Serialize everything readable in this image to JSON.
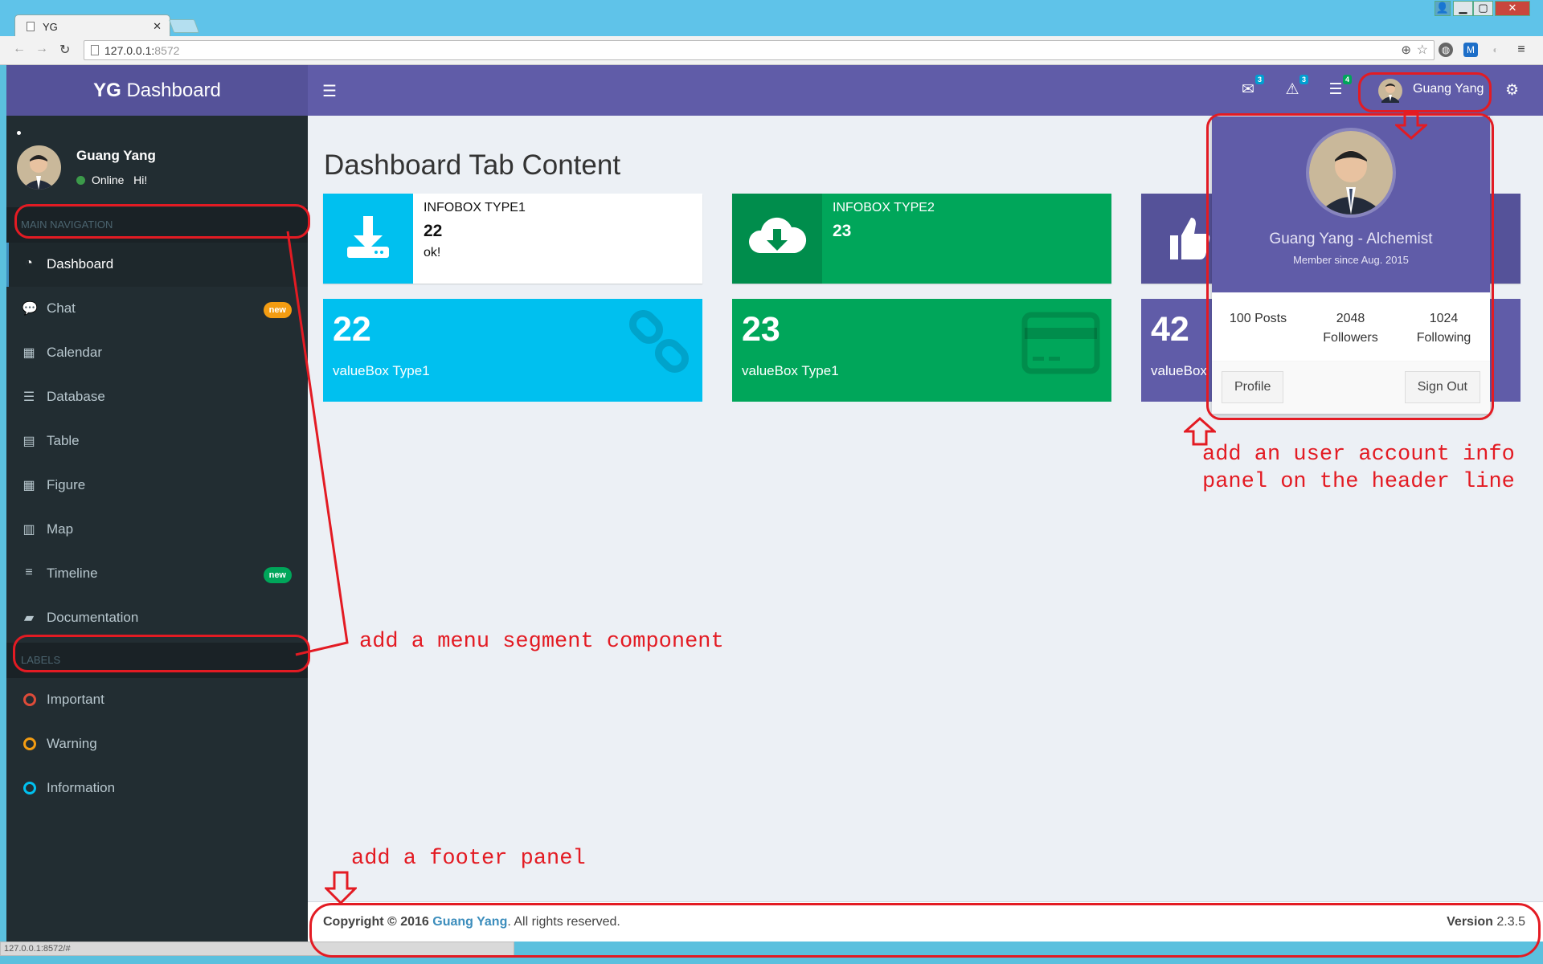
{
  "browser": {
    "tab_title": "YG",
    "url_host": "127.0.0.1:",
    "url_port": "8572",
    "status_url": "127.0.0.1:8572/#",
    "window_controls": [
      "user-icon",
      "minimize-icon",
      "maximize-icon",
      "close-icon"
    ]
  },
  "header": {
    "logo_bold": "YG",
    "logo_rest": " Dashboard",
    "messages_count": "3",
    "notifications_count": "3",
    "tasks_count": "4",
    "user_name": "Guang Yang"
  },
  "sidebar": {
    "user_name": "Guang Yang",
    "status": "Online",
    "status_extra": "Hi!",
    "section_main": "MAIN NAVIGATION",
    "items": [
      {
        "label": "Dashboard",
        "icon": "dashboard-icon"
      },
      {
        "label": "Chat",
        "icon": "chat-icon",
        "badge": "new"
      },
      {
        "label": "Calendar",
        "icon": "calendar-icon"
      },
      {
        "label": "Database",
        "icon": "database-icon"
      },
      {
        "label": "Table",
        "icon": "table-icon"
      },
      {
        "label": "Figure",
        "icon": "grid-icon"
      },
      {
        "label": "Map",
        "icon": "map-icon"
      },
      {
        "label": "Timeline",
        "icon": "list-icon",
        "badge": "new"
      },
      {
        "label": "Documentation",
        "icon": "book-icon"
      }
    ],
    "section_labels": "LABELS",
    "labels": [
      {
        "label": "Important",
        "color": "#dd4b39"
      },
      {
        "label": "Warning",
        "color": "#f39c12"
      },
      {
        "label": "Information",
        "color": "#00c0ef"
      }
    ]
  },
  "content": {
    "title": "Dashboard Tab Content",
    "infoboxes": [
      {
        "title": "INFOBOX TYPE1",
        "value": "22",
        "sub": "ok!",
        "icon": "download-icon"
      },
      {
        "title": "INFOBOX TYPE2",
        "value": "23",
        "icon": "cloud-download-icon"
      }
    ],
    "valueboxes": [
      {
        "value": "22",
        "label": "valueBox Type1",
        "icon": "chain-icon"
      },
      {
        "value": "23",
        "label": "valueBox Type1",
        "icon": "credit-card-icon"
      },
      {
        "value": "42",
        "label": "valueBox"
      }
    ]
  },
  "user_panel": {
    "name": "Guang Yang - Alchemist",
    "since": "Member since Aug. 2015",
    "posts": "100 Posts",
    "followers_count": "2048",
    "followers_label": "Followers",
    "following_count": "1024",
    "following_label": "Following",
    "profile_button": "Profile",
    "signout_button": "Sign Out"
  },
  "footer": {
    "copyright": "Copyright © 2016",
    "author": "Guang Yang",
    "rights": ". All rights reserved.",
    "version_label": "Version",
    "version": "2.3.5"
  },
  "annotations": {
    "menu_segment": "add a menu segment component",
    "user_panel_line1": "add an user account info",
    "user_panel_line2": "panel on the header line",
    "footer": "add a footer panel"
  },
  "colors": {
    "header": "#605ca8",
    "sidebar": "#222d32",
    "aqua": "#00c0ef",
    "green": "#00a65a",
    "purple": "#605ca8",
    "annotation": "#e31b23"
  }
}
